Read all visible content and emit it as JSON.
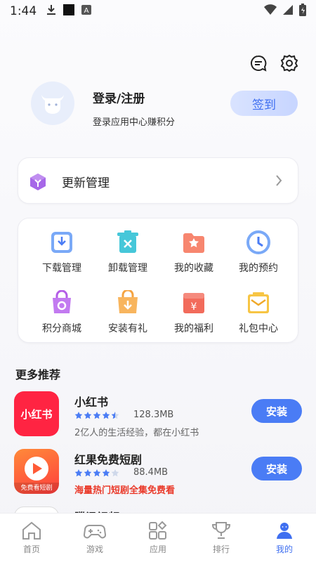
{
  "status_bar": {
    "time": "1:44"
  },
  "profile": {
    "login_title": "登录/注册",
    "login_subtitle": "登录应用中心赚积分",
    "signin_label": "签到"
  },
  "update_card": {
    "label": "更新管理"
  },
  "grid": {
    "items": [
      {
        "label": "下载管理",
        "icon": "download-icon"
      },
      {
        "label": "卸载管理",
        "icon": "uninstall-icon"
      },
      {
        "label": "我的收藏",
        "icon": "favorites-icon"
      },
      {
        "label": "我的预约",
        "icon": "reservation-icon"
      },
      {
        "label": "积分商城",
        "icon": "points-shop-icon"
      },
      {
        "label": "安装有礼",
        "icon": "install-gift-icon"
      },
      {
        "label": "我的福利",
        "icon": "welfare-icon"
      },
      {
        "label": "礼包中心",
        "icon": "gift-center-icon"
      }
    ]
  },
  "recommend": {
    "title": "更多推荐",
    "apps": [
      {
        "name": "小红书",
        "size": "128.3MB",
        "desc": "2亿人的生活经验，都在小红书",
        "rating": 4.5,
        "install_label": "安装",
        "icon_text": "小红书"
      },
      {
        "name": "红果免费短剧",
        "size": "88.4MB",
        "desc": "海量热门短剧全集免费看",
        "rating": 4,
        "install_label": "安装",
        "icon_text": "免费看短剧"
      },
      {
        "name": "腾讯视频"
      }
    ]
  },
  "bottom_nav": {
    "items": [
      {
        "label": "首页",
        "icon": "home-icon"
      },
      {
        "label": "游戏",
        "icon": "gamepad-icon"
      },
      {
        "label": "应用",
        "icon": "apps-icon"
      },
      {
        "label": "排行",
        "icon": "trophy-icon"
      },
      {
        "label": "我的",
        "icon": "profile-icon"
      }
    ],
    "active": "我的"
  },
  "colors": {
    "accent": "#3f6ff0",
    "install": "#4a7cf5",
    "hot_text": "#ea3a2a",
    "star": "#4a7cf5"
  }
}
